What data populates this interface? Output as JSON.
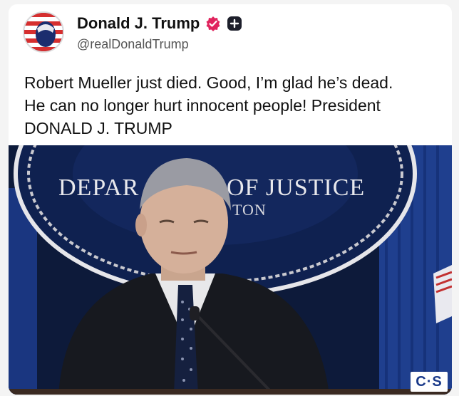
{
  "post": {
    "display_name": "Donald J. Trump",
    "handle": "@realDonaldTrump",
    "text_lines": [
      "Robert Mueller just died. Good, I’m glad he’s dead.",
      "He can no longer hurt innocent people! President",
      "DONALD J. TRUMP"
    ]
  },
  "media": {
    "seal_text_left": "DEPAR",
    "seal_text_right": "OF JUSTICE",
    "seal_text_bottom": "TON",
    "watermark": "C·S"
  },
  "icons": {
    "verified": "verified-badge-icon",
    "plus": "plus-icon"
  },
  "colors": {
    "verified_badge": "#e0245e",
    "plus_badge": "#1d1f2b",
    "backdrop": "#0d1a3a",
    "curtain": "#1f3f8e"
  }
}
